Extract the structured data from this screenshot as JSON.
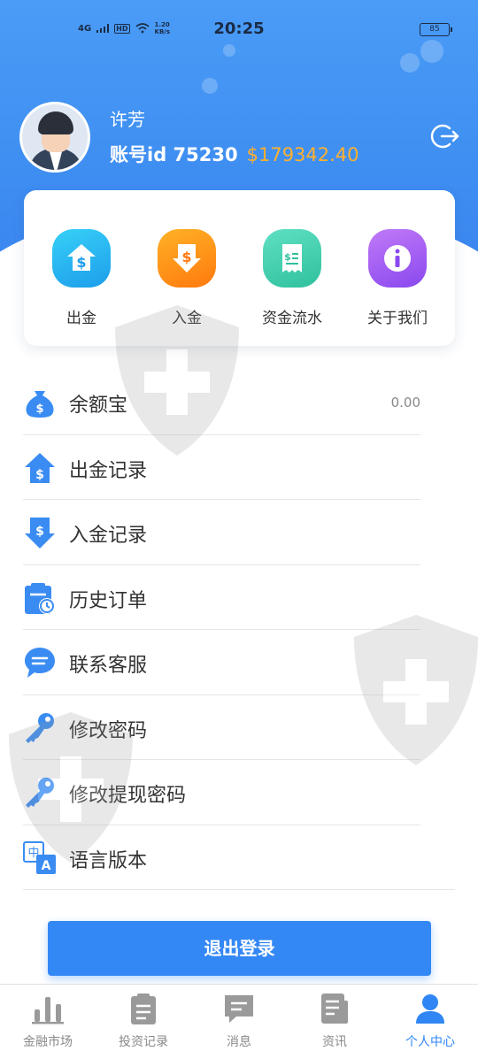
{
  "status_bar": {
    "network": "4G",
    "hd": "HD",
    "speed": "1.20",
    "speed_unit": "KB/s",
    "time": "20:25",
    "battery": "85"
  },
  "profile": {
    "username": "许芳",
    "account_label": "账号id 75230",
    "balance": "$179342.40"
  },
  "quick_actions": [
    {
      "label": "出金",
      "icon": "withdraw-house-dollar-icon",
      "color": "#22b6f0"
    },
    {
      "label": "入金",
      "icon": "deposit-arrow-dollar-icon",
      "color": "#ff8a15"
    },
    {
      "label": "资金流水",
      "icon": "receipt-dollar-icon",
      "color": "#3fd1b0"
    },
    {
      "label": "关于我们",
      "icon": "info-icon",
      "color": "#a25cf0"
    }
  ],
  "menu": [
    {
      "label": "余额宝",
      "value": "0.00",
      "icon": "money-bag-icon"
    },
    {
      "label": "出金记录",
      "icon": "house-dollar-icon"
    },
    {
      "label": "入金记录",
      "icon": "arrow-dollar-icon"
    },
    {
      "label": "历史订单",
      "icon": "clipboard-clock-icon"
    },
    {
      "label": "联系客服",
      "icon": "chat-bubble-icon"
    },
    {
      "label": "修改密码",
      "icon": "key-icon"
    },
    {
      "label": "修改提现密码",
      "icon": "key-icon"
    },
    {
      "label": "语言版本",
      "icon": "language-icon"
    }
  ],
  "logout_button": "退出登录",
  "tabs": [
    {
      "label": "金融市场",
      "icon": "bar-chart-icon",
      "active": false
    },
    {
      "label": "投资记录",
      "icon": "clipboard-icon",
      "active": false
    },
    {
      "label": "消息",
      "icon": "message-icon",
      "active": false
    },
    {
      "label": "资讯",
      "icon": "news-icon",
      "active": false
    },
    {
      "label": "个人中心",
      "icon": "person-icon",
      "active": true
    }
  ],
  "colors": {
    "primary": "#3488f5",
    "balance": "#ffb02e",
    "icon_blue": "#3a8cf2"
  }
}
